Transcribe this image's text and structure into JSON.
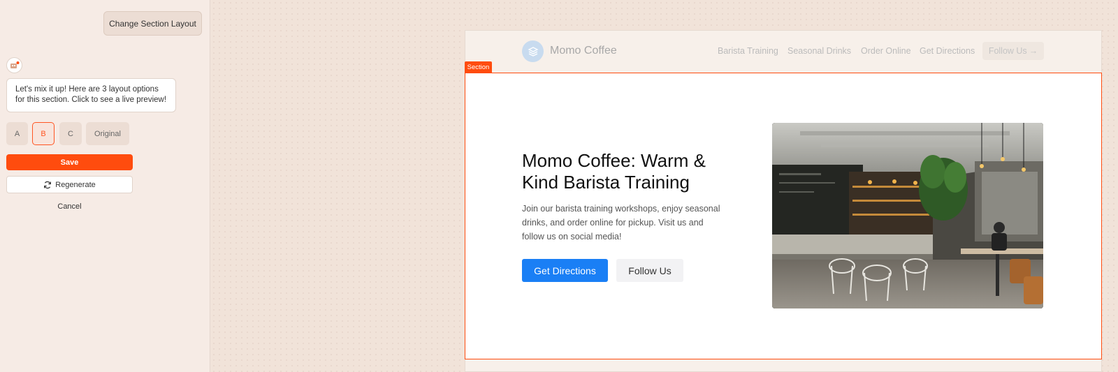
{
  "chat": {
    "user_message": "Change Section Layout",
    "bot_message": "Let's mix it up! Here are 3 layout options for this section. Click to see a live preview!",
    "options": [
      {
        "label": "A",
        "selected": false
      },
      {
        "label": "B",
        "selected": true
      },
      {
        "label": "C",
        "selected": false
      },
      {
        "label": "Original",
        "selected": false
      }
    ],
    "save_label": "Save",
    "regenerate_label": "Regenerate",
    "cancel_label": "Cancel"
  },
  "preview": {
    "section_tag": "Section",
    "brand": "Momo Coffee",
    "nav": [
      "Barista Training",
      "Seasonal Drinks",
      "Order Online",
      "Get Directions"
    ],
    "nav_cta": "Follow Us",
    "hero": {
      "title": "Momo Coffee: Warm & Kind Barista Training",
      "description": "Join our barista training workshops, enjoy seasonal drinks, and order online for pickup. Visit us and follow us on social media!",
      "primary_cta": "Get Directions",
      "secondary_cta": "Follow Us",
      "image_icon": "cafe-interior-photo"
    }
  },
  "colors": {
    "accent": "#ff4c0e",
    "primary_button": "#1a7ff5"
  }
}
